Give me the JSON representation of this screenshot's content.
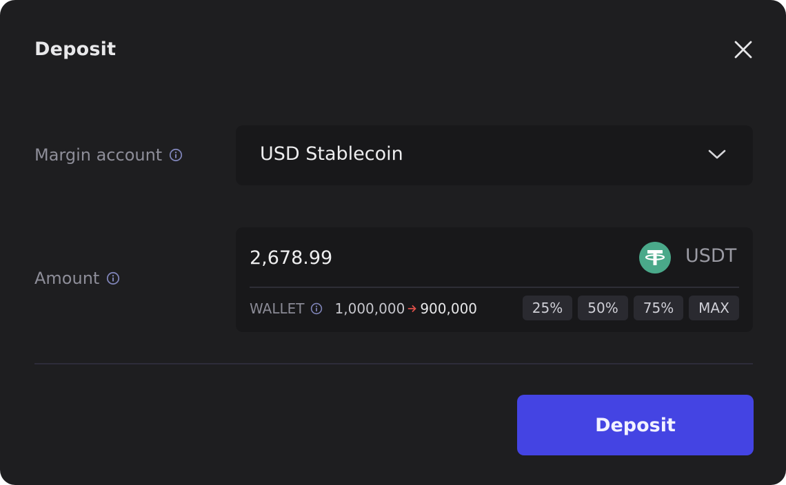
{
  "modal": {
    "title": "Deposit",
    "close_icon": "close-icon"
  },
  "margin_account": {
    "label": "Margin account",
    "selected": "USD Stablecoin",
    "icon": "chevron-down-icon"
  },
  "amount": {
    "label": "Amount",
    "value": "2,678.99",
    "token_symbol": "USDT",
    "token_icon": "tether-icon"
  },
  "wallet": {
    "label": "WALLET",
    "from": "1,000,000",
    "to": "900,000"
  },
  "quick_amounts": [
    "25%",
    "50%",
    "75%",
    "MAX"
  ],
  "submit": {
    "label": "Deposit"
  },
  "colors": {
    "background": "#1e1e20",
    "field": "#18181a",
    "accent": "#4444e3",
    "tether": "#4aa98a",
    "arrow": "#e0504a"
  }
}
